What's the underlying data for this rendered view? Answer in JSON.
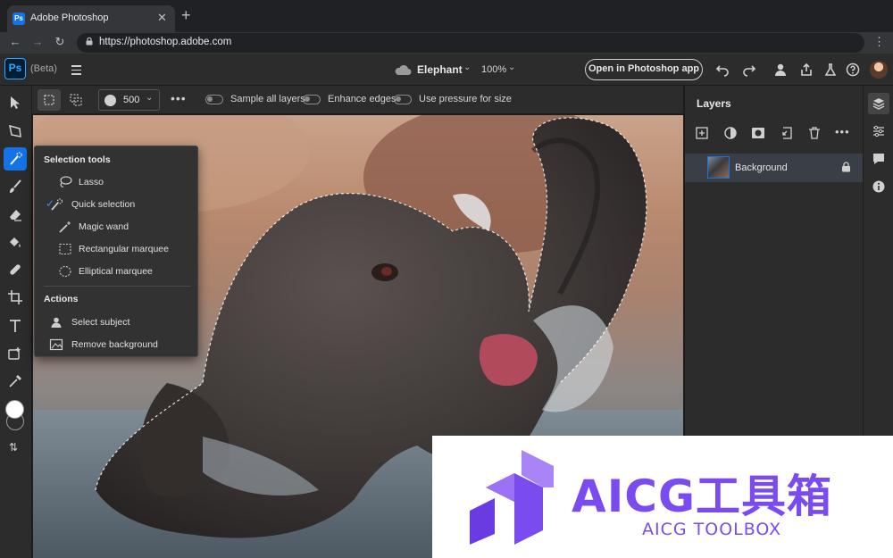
{
  "browser": {
    "tab_title": "Adobe Photoshop",
    "favicon_text": "Ps",
    "tab_close": "✕",
    "new_tab": "+",
    "url": "https://photoshop.adobe.com",
    "back": "←",
    "forward": "→",
    "reload": "↻",
    "menu": "⋮"
  },
  "header": {
    "logo": "Ps",
    "beta_label": "(Beta)",
    "document_name": "Elephant",
    "zoom": "100%",
    "open_app_label": "Open in Photoshop app",
    "chevron": "⌄"
  },
  "options_bar": {
    "brush_size": "500",
    "more": "•••",
    "toggles": [
      {
        "label": "Sample all layers",
        "on": false
      },
      {
        "label": "Enhance edges",
        "on": false
      },
      {
        "label": "Use pressure for size",
        "on": false
      }
    ]
  },
  "flyout": {
    "heading_selection": "Selection tools",
    "selection_items": [
      {
        "label": "Lasso",
        "icon": "lasso-icon",
        "active": false
      },
      {
        "label": "Quick selection",
        "icon": "quick-selection-icon",
        "active": true
      },
      {
        "label": "Magic wand",
        "icon": "magic-wand-icon",
        "active": false
      },
      {
        "label": "Rectangular marquee",
        "icon": "rectangular-marquee-icon",
        "active": false
      },
      {
        "label": "Elliptical marquee",
        "icon": "elliptical-marquee-icon",
        "active": false
      }
    ],
    "check": "✓",
    "heading_actions": "Actions",
    "action_items": [
      {
        "label": "Select subject",
        "icon": "select-subject-icon"
      },
      {
        "label": "Remove background",
        "icon": "remove-background-icon"
      }
    ]
  },
  "layers_panel": {
    "title": "Layers",
    "more": "•••",
    "layers": [
      {
        "name": "Background",
        "locked": true
      }
    ]
  },
  "toolbar": {
    "swap": "⇅"
  },
  "watermark": {
    "title_cn": "AICG工具箱",
    "title_en": "AICG TOOLBOX"
  },
  "colors": {
    "accent": "#1473e6",
    "panel": "#2c2c2c",
    "watermark_purple": "#7a4cf0"
  }
}
